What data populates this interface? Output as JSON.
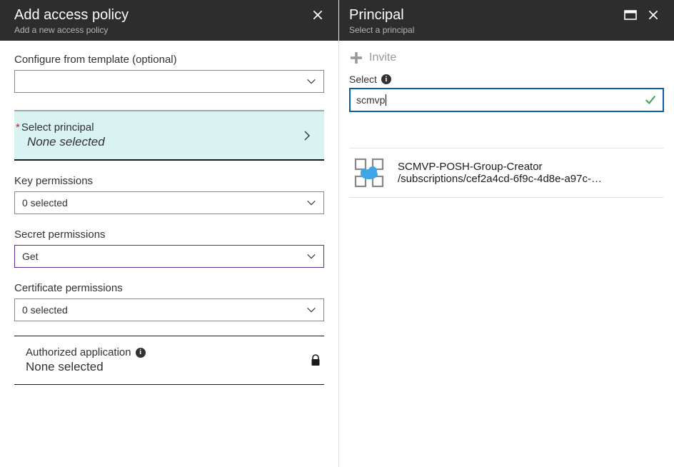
{
  "left": {
    "title": "Add access policy",
    "subtitle": "Add a new access policy",
    "configure_label": "Configure from template (optional)",
    "configure_value": "",
    "principal_label": "Select principal",
    "principal_value": "None selected",
    "key_perm_label": "Key permissions",
    "key_perm_value": "0 selected",
    "secret_perm_label": "Secret permissions",
    "secret_perm_value": "Get",
    "cert_perm_label": "Certificate permissions",
    "cert_perm_value": "0 selected",
    "auth_app_label": "Authorized application",
    "auth_app_value": "None selected"
  },
  "right": {
    "title": "Principal",
    "subtitle": "Select a principal",
    "invite_label": "Invite",
    "select_label": "Select",
    "search_value": "scmvp",
    "results": [
      {
        "title": "SCMVP-POSH-Group-Creator",
        "sub": "/subscriptions/cef2a4cd-6f9c-4d8e-a97c-…"
      }
    ]
  }
}
